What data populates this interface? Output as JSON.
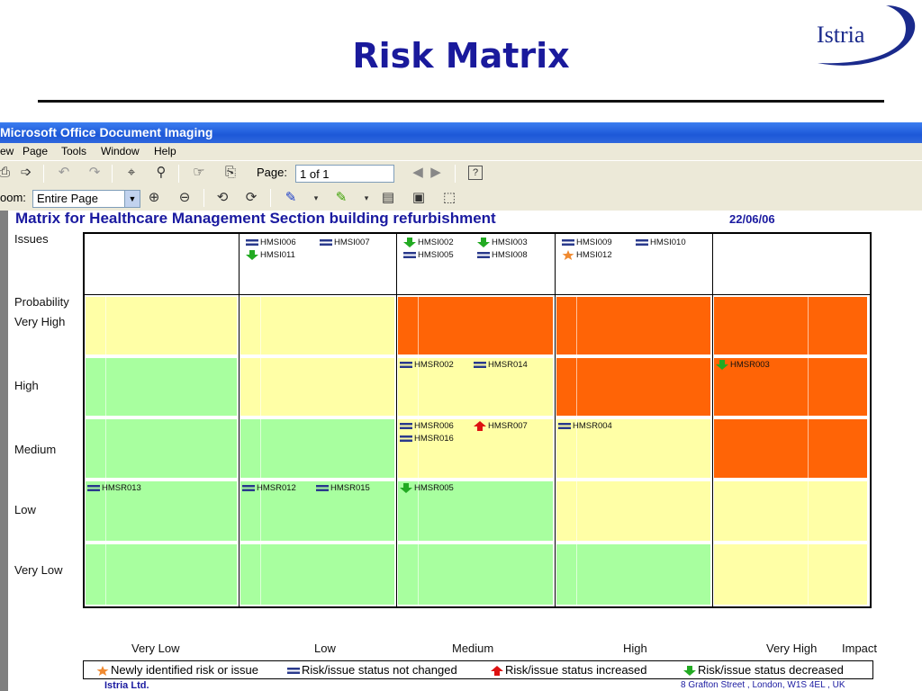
{
  "slide": {
    "title": "Risk Matrix",
    "logo": "Istria"
  },
  "window": {
    "title": "Microsoft Office Document Imaging",
    "menu": [
      "ew",
      "Page",
      "Tools",
      "Window",
      "Help"
    ],
    "page_label": "Page:",
    "page_value": "1 of 1",
    "zoom_label": "oom:",
    "zoom_value": "Entire Page"
  },
  "document": {
    "title": "Matrix for  Healthcare Management Section building refurbishment",
    "date": "22/06/06",
    "row_labels": {
      "issues": "Issues",
      "probability": "Probability",
      "very_high": "Very High",
      "high": "High",
      "medium": "Medium",
      "low": "Low",
      "very_low": "Very Low"
    },
    "impact_labels": [
      "Very Low",
      "Low",
      "Medium",
      "High",
      "Very High"
    ],
    "impact_title": "Impact",
    "issues_row": [
      [],
      [
        {
          "id": "HMSI006",
          "status": "unchanged"
        },
        {
          "id": "HMSI007",
          "status": "unchanged"
        },
        {
          "id": "HMSI011",
          "status": "decreased"
        }
      ],
      [
        {
          "id": "HMSI002",
          "status": "decreased"
        },
        {
          "id": "HMSI003",
          "status": "decreased"
        },
        {
          "id": "HMSI005",
          "status": "unchanged"
        },
        {
          "id": "HMSI008",
          "status": "unchanged"
        }
      ],
      [
        {
          "id": "HMSI009",
          "status": "unchanged"
        },
        {
          "id": "HMSI010",
          "status": "unchanged"
        },
        {
          "id": "HMSI012",
          "status": "new"
        }
      ],
      []
    ],
    "risk_cells": [
      {
        "row": "very_high",
        "col": 2,
        "items": []
      },
      {
        "row": "high",
        "col": 2,
        "items": [
          {
            "id": "HMSR002",
            "status": "unchanged"
          },
          {
            "id": "HMSR014",
            "status": "unchanged"
          }
        ]
      },
      {
        "row": "high",
        "col": 4,
        "items": [
          {
            "id": "HMSR003",
            "status": "decreased"
          }
        ]
      },
      {
        "row": "medium",
        "col": 2,
        "items": [
          {
            "id": "HMSR006",
            "status": "unchanged"
          },
          {
            "id": "HMSR007",
            "status": "increased"
          },
          {
            "id": "HMSR016",
            "status": "unchanged"
          }
        ]
      },
      {
        "row": "medium",
        "col": 3,
        "items": [
          {
            "id": "HMSR004",
            "status": "unchanged"
          }
        ]
      },
      {
        "row": "low",
        "col": 0,
        "items": [
          {
            "id": "HMSR013",
            "status": "unchanged"
          }
        ]
      },
      {
        "row": "low",
        "col": 1,
        "items": [
          {
            "id": "HMSR012",
            "status": "unchanged"
          },
          {
            "id": "HMSR015",
            "status": "unchanged"
          }
        ]
      },
      {
        "row": "low",
        "col": 2,
        "items": [
          {
            "id": "HMSR005",
            "status": "decreased"
          }
        ]
      }
    ],
    "legend": {
      "new": "Newly identified risk or issue",
      "unchanged": "Risk/issue status not changed",
      "increased": "Risk/issue status increased",
      "decreased": "Risk/issue status decreased"
    },
    "footer_left": "Istria Ltd.",
    "footer_right": "8 Grafton Street , London, W1S 4EL , UK"
  },
  "colors": {
    "green": "#a8ff9f",
    "yellow": "#ffffa6",
    "orange": "#ff6406",
    "title_blue": "#1a1aa0"
  }
}
